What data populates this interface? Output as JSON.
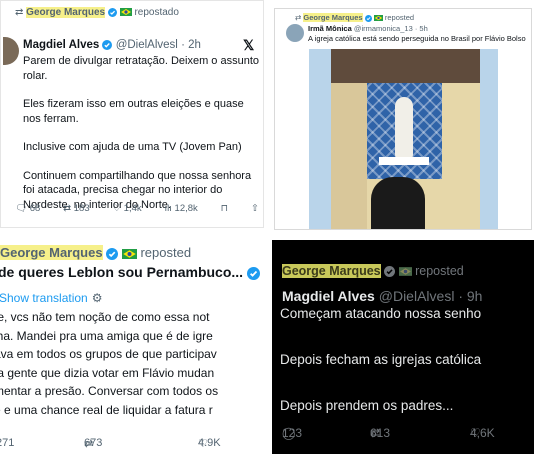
{
  "panel1": {
    "reposted_by": "George Marques",
    "reposted_label": "repostado",
    "author_name": "Magdiel Alves",
    "author_handle": "@DielAlvesl",
    "time": "· 2h",
    "paragraphs": [
      "Parem de divulgar retratação. Deixem o assunto rolar.",
      "Eles fizeram isso em outras eleições e quase nos ferram.",
      "Inclusive com ajuda de uma TV (Jovem Pan)",
      "Continuem compartilhando que nossa senhora foi atacada, precisa chegar no interior do Nordeste, no interior do Norte."
    ],
    "replies": "68",
    "reposts": "183",
    "likes": "1,4k",
    "views": "12,8k"
  },
  "panel2": {
    "reposted_by": "George Marques",
    "reposted_label": "reposted",
    "author_name": "Irmã Mônica",
    "author_handle": "@irmamonica_13",
    "time": "· 5h",
    "text": "A igreja católica está sendo perseguida no Brasil por Flávio Bolso"
  },
  "panel3": {
    "reposted_by": "George Marques",
    "reposted_label": "reposted",
    "author_name": "de queres Leblon sou Pernambuco...",
    "show_translation": "Show translation",
    "lines": [
      "te, vcs não tem noção de como essa not",
      "lha. Mandei pra uma amiga que é de igre",
      "ava em todos os grupos de que participav",
      "ta gente que dizia votar em Flávio mudan",
      "mentar a presão. Conversar com todos os",
      "e e uma chance real de liquidar a fatura r"
    ],
    "replies": "271",
    "reposts": "673",
    "likes": "4.9K"
  },
  "panel4": {
    "reposted_by": "George Marques",
    "reposted_label": "reposted",
    "author_name": "Magdiel Alves",
    "author_handle": "@DielAlvesl",
    "time": "· 9h",
    "lines": [
      "Começam atacando nossa senho",
      "Depois fecham as igrejas católica",
      "Depois prendem os padres..."
    ],
    "replies": "123",
    "reposts": "613",
    "likes": "4,6K"
  },
  "colors": {
    "highlight": "#f6f08a",
    "verified_blue": "#1d9bf0",
    "flag_green": "#229e45",
    "flag_yellow": "#f8e509",
    "dark_bg": "#000000"
  },
  "icons": [
    "retweet-icon",
    "verified-icon",
    "brazil-flag-icon",
    "reply-icon",
    "like-icon",
    "views-icon",
    "bookmark-icon",
    "share-icon",
    "x-logo-icon",
    "gear-icon"
  ]
}
